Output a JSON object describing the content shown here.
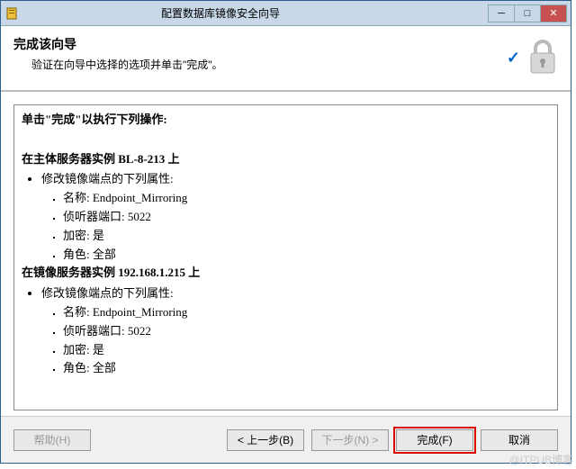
{
  "window": {
    "title": "配置数据库镜像安全向导"
  },
  "header": {
    "title": "完成该向导",
    "subtitle": "验证在向导中选择的选项并单击\"完成\"。"
  },
  "content": {
    "intro": "单击\"完成\"以执行下列操作:",
    "sections": [
      {
        "title": "在主体服务器实例 BL-8-213 上",
        "item": "修改镜像端点的下列属性:",
        "props": [
          "名称: Endpoint_Mirroring",
          "侦听器端口: 5022",
          "加密: 是",
          "角色: 全部"
        ]
      },
      {
        "title": "在镜像服务器实例 192.168.1.215 上",
        "item": "修改镜像端点的下列属性:",
        "props": [
          "名称: Endpoint_Mirroring",
          "侦听器端口: 5022",
          "加密: 是",
          "角色: 全部"
        ]
      }
    ]
  },
  "footer": {
    "help": "帮助(H)",
    "back": "< 上一步(B)",
    "next": "下一步(N) >",
    "finish": "完成(F)",
    "cancel": "取消"
  },
  "watermark": "@ITPUB博客"
}
